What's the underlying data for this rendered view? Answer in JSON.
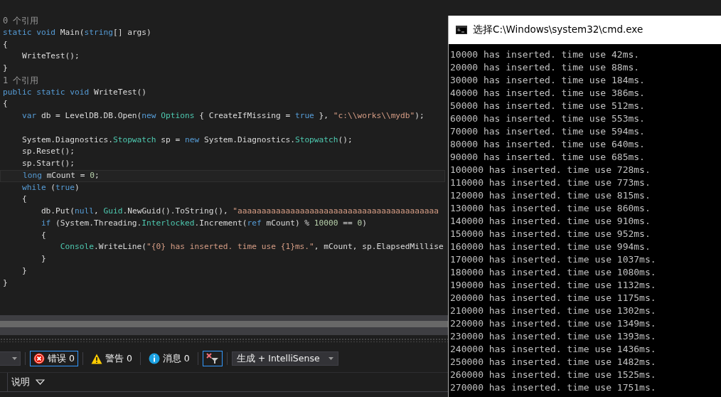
{
  "editor": {
    "lines": [
      {
        "kind": "lens",
        "text": "0 个引用",
        "current": false
      },
      {
        "kind": "code",
        "current": false,
        "tokens": [
          {
            "kind": "kw",
            "text": "static void "
          },
          {
            "kind": "pl",
            "text": "Main("
          },
          {
            "kind": "kw",
            "text": "string"
          },
          {
            "kind": "pl",
            "text": "[] args)"
          }
        ]
      },
      {
        "kind": "code",
        "current": false,
        "tokens": [
          {
            "kind": "pl",
            "text": "{"
          }
        ]
      },
      {
        "kind": "code",
        "current": false,
        "tokens": [
          {
            "kind": "pl",
            "text": "    WriteTest();"
          }
        ]
      },
      {
        "kind": "code",
        "current": false,
        "tokens": [
          {
            "kind": "pl",
            "text": "}"
          }
        ]
      },
      {
        "kind": "lens",
        "text": "1 个引用",
        "current": false
      },
      {
        "kind": "code",
        "current": false,
        "tokens": [
          {
            "kind": "kw",
            "text": "public static void "
          },
          {
            "kind": "pl",
            "text": "WriteTest()"
          }
        ]
      },
      {
        "kind": "code",
        "current": false,
        "tokens": [
          {
            "kind": "pl",
            "text": "{"
          }
        ]
      },
      {
        "kind": "code",
        "current": false,
        "tokens": [
          {
            "kind": "kw",
            "text": "    var "
          },
          {
            "kind": "pl",
            "text": "db = LevelDB.DB.Open("
          },
          {
            "kind": "kw",
            "text": "new "
          },
          {
            "kind": "ty",
            "text": "Options"
          },
          {
            "kind": "pl",
            "text": " { CreateIfMissing = "
          },
          {
            "kind": "kw",
            "text": "true"
          },
          {
            "kind": "pl",
            "text": " }, "
          },
          {
            "kind": "st",
            "text": "\"c:\\\\works\\\\mydb\""
          },
          {
            "kind": "pl",
            "text": ");"
          }
        ]
      },
      {
        "kind": "blank",
        "current": false
      },
      {
        "kind": "code",
        "current": false,
        "tokens": [
          {
            "kind": "pl",
            "text": "    System.Diagnostics."
          },
          {
            "kind": "ty",
            "text": "Stopwatch"
          },
          {
            "kind": "pl",
            "text": " sp = "
          },
          {
            "kind": "kw",
            "text": "new "
          },
          {
            "kind": "pl",
            "text": "System.Diagnostics."
          },
          {
            "kind": "ty",
            "text": "Stopwatch"
          },
          {
            "kind": "pl",
            "text": "();"
          }
        ]
      },
      {
        "kind": "code",
        "current": false,
        "tokens": [
          {
            "kind": "pl",
            "text": "    sp.Reset();"
          }
        ]
      },
      {
        "kind": "code",
        "current": false,
        "tokens": [
          {
            "kind": "pl",
            "text": "    sp.Start();"
          }
        ]
      },
      {
        "kind": "code",
        "current": true,
        "tokens": [
          {
            "kind": "kw",
            "text": "    long "
          },
          {
            "kind": "pl",
            "text": "mCount = "
          },
          {
            "kind": "nu",
            "text": "0"
          },
          {
            "kind": "pl",
            "text": ";"
          }
        ]
      },
      {
        "kind": "code",
        "current": false,
        "tokens": [
          {
            "kind": "kw",
            "text": "    while "
          },
          {
            "kind": "pl",
            "text": "("
          },
          {
            "kind": "kw",
            "text": "true"
          },
          {
            "kind": "pl",
            "text": ")"
          }
        ]
      },
      {
        "kind": "code",
        "current": false,
        "tokens": [
          {
            "kind": "pl",
            "text": "    {"
          }
        ]
      },
      {
        "kind": "code",
        "current": false,
        "tokens": [
          {
            "kind": "pl",
            "text": "        db.Put("
          },
          {
            "kind": "kw",
            "text": "null"
          },
          {
            "kind": "pl",
            "text": ", "
          },
          {
            "kind": "ty",
            "text": "Guid"
          },
          {
            "kind": "pl",
            "text": ".NewGuid().ToString(), "
          },
          {
            "kind": "st",
            "text": "\"aaaaaaaaaaaaaaaaaaaaaaaaaaaaaaaaaaaaaaaaaa"
          }
        ]
      },
      {
        "kind": "code",
        "current": false,
        "tokens": [
          {
            "kind": "kw",
            "text": "        if "
          },
          {
            "kind": "pl",
            "text": "(System.Threading."
          },
          {
            "kind": "ty",
            "text": "Interlocked"
          },
          {
            "kind": "pl",
            "text": ".Increment("
          },
          {
            "kind": "kw",
            "text": "ref "
          },
          {
            "kind": "pl",
            "text": "mCount) % "
          },
          {
            "kind": "nu",
            "text": "10000"
          },
          {
            "kind": "pl",
            "text": " == "
          },
          {
            "kind": "nu",
            "text": "0"
          },
          {
            "kind": "pl",
            "text": ")"
          }
        ]
      },
      {
        "kind": "code",
        "current": false,
        "tokens": [
          {
            "kind": "pl",
            "text": "        {"
          }
        ]
      },
      {
        "kind": "code",
        "current": false,
        "tokens": [
          {
            "kind": "ty",
            "text": "            Console"
          },
          {
            "kind": "pl",
            "text": ".WriteLine("
          },
          {
            "kind": "st",
            "text": "\"{0} has inserted. time use {1}ms.\""
          },
          {
            "kind": "pl",
            "text": ", mCount, sp.ElapsedMillise"
          }
        ]
      },
      {
        "kind": "code",
        "current": false,
        "tokens": [
          {
            "kind": "pl",
            "text": "        }"
          }
        ]
      },
      {
        "kind": "code",
        "current": false,
        "tokens": [
          {
            "kind": "pl",
            "text": "    }"
          }
        ]
      },
      {
        "kind": "code",
        "current": false,
        "tokens": [
          {
            "kind": "pl",
            "text": "}"
          }
        ]
      }
    ]
  },
  "error_list": {
    "filters": [
      {
        "kind": "error",
        "label": "错误 0",
        "selected": true
      },
      {
        "kind": "warning",
        "label": "警告 0",
        "selected": false
      },
      {
        "kind": "info",
        "label": "消息 0",
        "selected": false
      }
    ],
    "clear_filter": {
      "selected": true
    },
    "source": {
      "value": "生成 + IntelliSense"
    },
    "columns": [
      "说明"
    ]
  },
  "console": {
    "title": "选择C:\\Windows\\system32\\cmd.exe",
    "lines": [
      "10000 has inserted. time use 42ms.",
      "20000 has inserted. time use 88ms.",
      "30000 has inserted. time use 184ms.",
      "40000 has inserted. time use 386ms.",
      "50000 has inserted. time use 512ms.",
      "60000 has inserted. time use 553ms.",
      "70000 has inserted. time use 594ms.",
      "80000 has inserted. time use 640ms.",
      "90000 has inserted. time use 685ms.",
      "100000 has inserted. time use 728ms.",
      "110000 has inserted. time use 773ms.",
      "120000 has inserted. time use 815ms.",
      "130000 has inserted. time use 860ms.",
      "140000 has inserted. time use 910ms.",
      "150000 has inserted. time use 952ms.",
      "160000 has inserted. time use 994ms.",
      "170000 has inserted. time use 1037ms.",
      "180000 has inserted. time use 1080ms.",
      "190000 has inserted. time use 1132ms.",
      "200000 has inserted. time use 1175ms.",
      "210000 has inserted. time use 1302ms.",
      "220000 has inserted. time use 1349ms.",
      "230000 has inserted. time use 1393ms.",
      "240000 has inserted. time use 1436ms.",
      "250000 has inserted. time use 1482ms.",
      "260000 has inserted. time use 1525ms.",
      "270000 has inserted. time use 1751ms."
    ]
  }
}
